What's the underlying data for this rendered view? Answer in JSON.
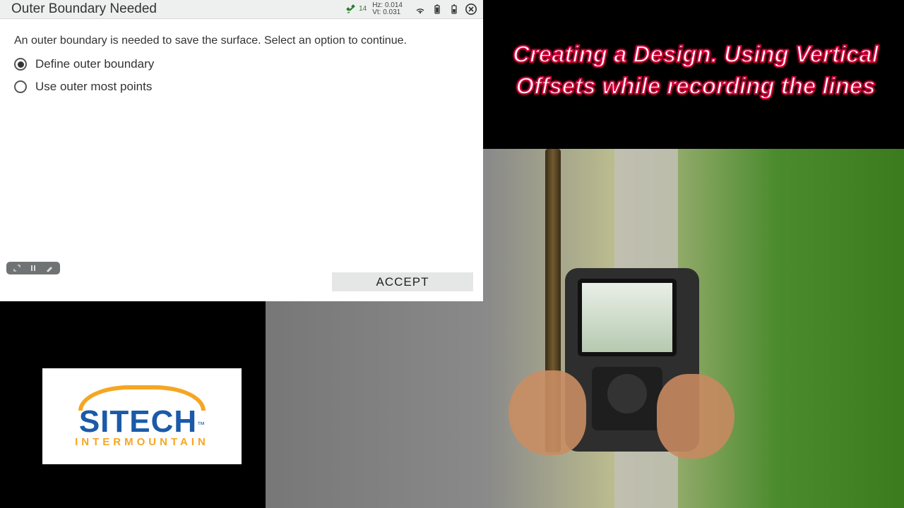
{
  "overlay": {
    "title_line1": "Creating a Design. Using Vertical",
    "title_line2": "Offsets while recording the lines"
  },
  "logo": {
    "main": "SITECH",
    "tm": "™",
    "sub": "INTERMOUNTAIN"
  },
  "app": {
    "header": {
      "title": "Outer Boundary Needed",
      "sat_count": "14",
      "hz_label": "Hz:",
      "hz_value": "0.014",
      "vt_label": "Vt:",
      "vt_value": "0.031",
      "satellite_icon": "satellite-icon",
      "correction_icon": "corrections-icon",
      "battery1_icon": "battery-icon",
      "battery2_icon": "battery-icon",
      "close_icon": "close-icon"
    },
    "body": {
      "instruction": "An outer boundary is needed to save the surface. Select an option to continue.",
      "options": [
        {
          "label": "Define outer boundary",
          "selected": true
        },
        {
          "label": "Use outer most points",
          "selected": false
        }
      ],
      "accept": "ACCEPT"
    },
    "ctrl": {
      "expand_icon": "expand-icon",
      "pause_icon": "pause-icon",
      "draw_icon": "draw-icon"
    }
  }
}
